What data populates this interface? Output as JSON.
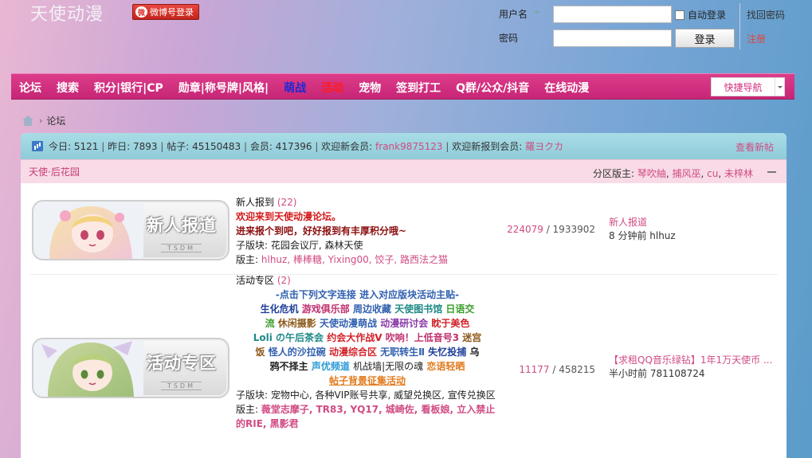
{
  "site": {
    "title": "天使动漫",
    "weibo_login": "微博号登录"
  },
  "login": {
    "username_label": "用户名",
    "password_label": "密码",
    "remember_label": "自动登录",
    "login_button": "登录",
    "find_password": "找回密码",
    "register": "注册"
  },
  "nav": {
    "items": [
      {
        "label": "论坛"
      },
      {
        "label": "搜索"
      },
      {
        "label": "积分|银行|CP"
      },
      {
        "label": "勋章|称号牌|风格|"
      },
      {
        "label": "萌战"
      },
      {
        "label": "活动"
      },
      {
        "label": "宠物"
      },
      {
        "label": "签到打工"
      },
      {
        "label": "Q群/公众/抖音"
      },
      {
        "label": "在线动漫"
      }
    ],
    "quick_nav": "快捷导航"
  },
  "breadcrumb": {
    "current": "论坛",
    "sep": "›"
  },
  "stats": {
    "today_label": "今日:",
    "today": "5121",
    "yesterday_label": "昨日:",
    "yesterday": "7893",
    "posts_label": "帖子:",
    "posts": "45150483",
    "members_label": "会员:",
    "members": "417396",
    "welcome_label": "欢迎新会员:",
    "new_member": "frank9875123",
    "welcome_report_label": "欢迎新报到会员:",
    "new_report_member": "羅ヨクカ",
    "view_new": "查看新帖"
  },
  "section": {
    "title": "天使·后花园",
    "moderators_label": "分区版主:",
    "moderators": [
      "琴吹紬",
      "捕风巫",
      "cu",
      "未梓林"
    ]
  },
  "forums": [
    {
      "banner_text": "新人报道",
      "banner_sub": "TSDM",
      "name": "新人报到",
      "count": "(22)",
      "desc_line1": "欢迎来到天使动漫论坛。",
      "desc_line2": "进来报个到吧，好好报到有丰厚积分哦~",
      "sub_label": "子版块:",
      "sub_forums": "花园会议厅, 森林天使",
      "mod_label": "版主:",
      "moderators": "hlhuz, 棒棒糖, Yixing00, 饺子, 路西法之猫",
      "threads": "224079",
      "posts": "1933902",
      "last_title": "新人报道",
      "last_time": "8 分钟前 hlhuz"
    },
    {
      "banner_text": "活动专区",
      "banner_sub": "TSDM",
      "name": "活动专区",
      "count": "(2)",
      "act_intro": "-点击下列文字连接 进入对应版块活动主贴-",
      "act_links": {
        "l1": "生化危机",
        "l2": "游戏俱乐部",
        "l3": "周边收藏",
        "l4": "天使图书馆",
        "l5": "日语交",
        "l6": "流",
        "l7": "休闲摄影",
        "l8": "天使动漫萌战",
        "l9": "动漫研讨会",
        "l10": "眈于美色",
        "l11": "Loli の午后茶会",
        "l12": "约会大作战V",
        "l13": "吹响！上低音号3",
        "l14": "迷宫",
        "l15": "饭",
        "l16": "怪人的沙拉碗",
        "l17": "动漫综合区",
        "l18": "无职转生Ⅱ",
        "l19": "失忆投捕",
        "l20": "乌",
        "l21": "鸦不择主",
        "l22": "声优频道",
        "l23": "机战墙|无限の魂",
        "l24": "恋语轻晒",
        "l25": "帖子背景征集活动"
      },
      "sub_label": "子版块:",
      "sub_forums": "宠物中心, 各种VIP账号共享, 威望兑换区, 宣传兑换区",
      "mod_label": "版主:",
      "moderators": "薇堂志摩子, TR83, YQ17, 城崎佐, 看板娘, 立入禁止的RIE, 黑影君",
      "threads": "11177",
      "posts": "458215",
      "last_title": "【求租QQ音乐绿钻】1年1万天使币 ...",
      "last_time": "半小时前 781108724"
    }
  ]
}
